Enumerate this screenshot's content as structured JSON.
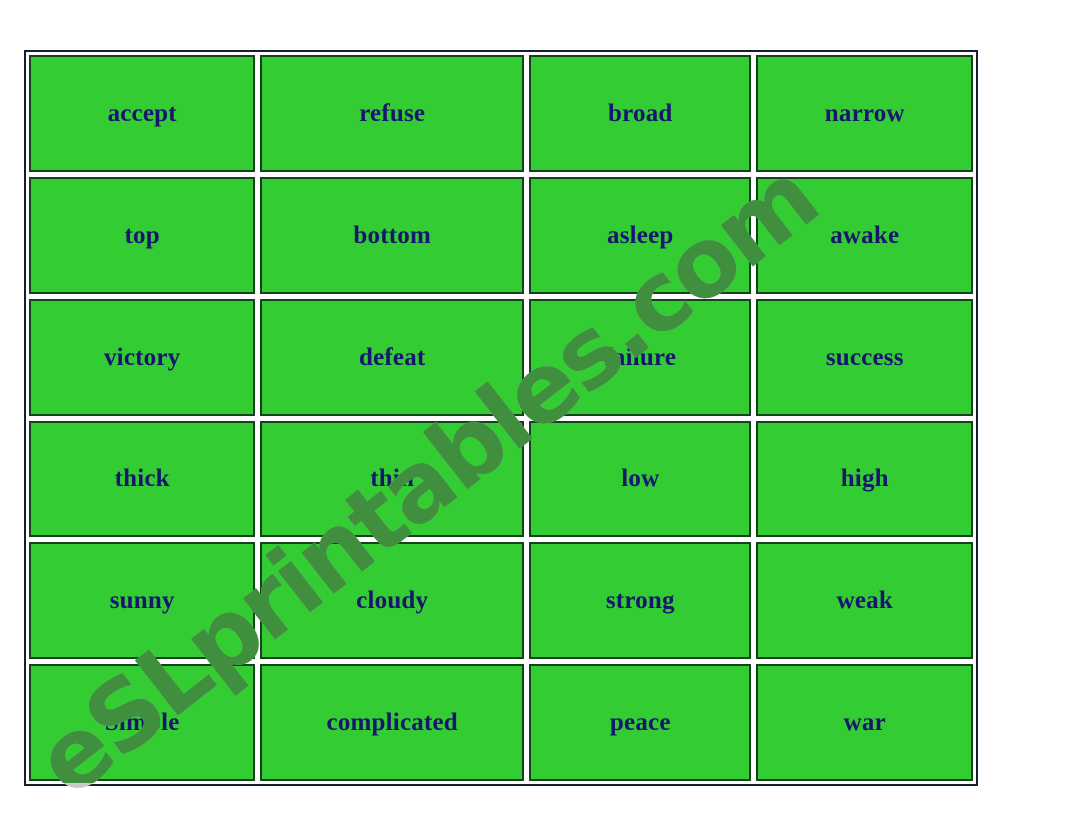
{
  "worksheet": {
    "type": "flashcard-grid",
    "columns": 4,
    "rows": 6,
    "card_fill_color": "#33cc33",
    "card_border_color": "#14421c",
    "text_color": "#16166e",
    "frame_color": "#14202e",
    "cards": [
      {
        "label": "accept"
      },
      {
        "label": "refuse"
      },
      {
        "label": "broad"
      },
      {
        "label": "narrow"
      },
      {
        "label": "top"
      },
      {
        "label": "bottom"
      },
      {
        "label": "asleep"
      },
      {
        "label": "awake"
      },
      {
        "label": "victory"
      },
      {
        "label": "defeat"
      },
      {
        "label": "failure"
      },
      {
        "label": "success"
      },
      {
        "label": "thick"
      },
      {
        "label": "thin"
      },
      {
        "label": "low"
      },
      {
        "label": "high"
      },
      {
        "label": "sunny"
      },
      {
        "label": "cloudy"
      },
      {
        "label": "strong"
      },
      {
        "label": "weak"
      },
      {
        "label": "Simple"
      },
      {
        "label": "complicated"
      },
      {
        "label": "peace"
      },
      {
        "label": "war"
      }
    ]
  },
  "watermark": {
    "text": "eSLprintables.com",
    "base_color": "#c9c9c9",
    "overlay_color": "#3f8f3f"
  }
}
